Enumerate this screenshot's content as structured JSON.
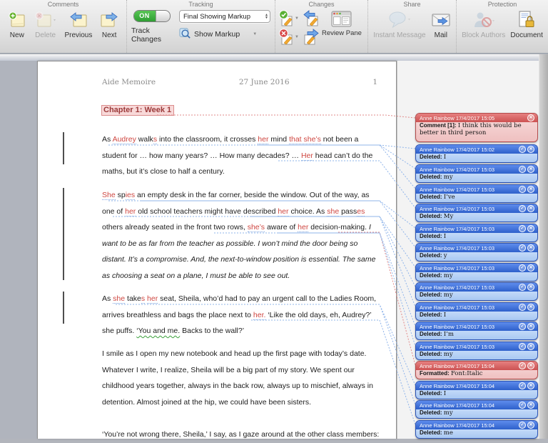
{
  "ribbon": {
    "comments": {
      "label": "Comments",
      "new": "New",
      "delete": "Delete",
      "previous": "Previous",
      "next": "Next"
    },
    "tracking": {
      "label": "Tracking",
      "toggle_state": "ON",
      "track_changes": "Track Changes",
      "view_mode": "Final Showing Markup",
      "show_markup": "Show Markup"
    },
    "changes": {
      "label": "Changes",
      "review_pane": "Review Pane"
    },
    "share": {
      "label": "Share",
      "instant_message": "Instant Message",
      "mail": "Mail"
    },
    "protection": {
      "label": "Protection",
      "block_authors": "Block Authors",
      "document": "Document"
    }
  },
  "document": {
    "header": {
      "title": "Aide Memoire",
      "date": "27 June 2016",
      "page_number": "1"
    },
    "chapter_heading": "Chapter 1: Week 1",
    "paragraphs": [
      {
        "runs": [
          {
            "t": "As ",
            "s": "n"
          },
          {
            "t": "Audrey",
            "s": "ins"
          },
          {
            "t": " walk",
            "s": "n"
          },
          {
            "t": "s",
            "s": "ins"
          },
          {
            "t": " into the classroom, it crosses ",
            "s": "n"
          },
          {
            "t": "her",
            "s": "ins"
          },
          {
            "t": " mind ",
            "s": "n"
          },
          {
            "t": "that she’s",
            "s": "ins"
          },
          {
            "t": " not been a student for … how many years? … How many decades? … ",
            "s": "n"
          },
          {
            "t": "Her",
            "s": "ins"
          },
          {
            "t": " head can’t do the maths, but it’s close to half a century.",
            "s": "n"
          }
        ]
      },
      {
        "runs": [
          {
            "t": "She",
            "s": "ins"
          },
          {
            "t": " sp",
            "s": "n"
          },
          {
            "t": "ies",
            "s": "ins"
          },
          {
            "t": " an empty desk in the far corner, beside the window. Out of the way, as one of ",
            "s": "n"
          },
          {
            "t": "her",
            "s": "ins"
          },
          {
            "t": " old school teachers might have described ",
            "s": "n"
          },
          {
            "t": "her",
            "s": "ins"
          },
          {
            "t": " choice. As ",
            "s": "n"
          },
          {
            "t": "she",
            "s": "ins"
          },
          {
            "t": " pass",
            "s": "n"
          },
          {
            "t": "es",
            "s": "ins"
          },
          {
            "t": " others already seated in the front two rows, ",
            "s": "n"
          },
          {
            "t": "she’s",
            "s": "ins"
          },
          {
            "t": " aware of ",
            "s": "n"
          },
          {
            "t": "her",
            "s": "ins"
          },
          {
            "t": " decision-making. ",
            "s": "n"
          },
          {
            "t": "I want to be as far from the teacher as possible. I won’t mind the door being so distant. It’s a compromise. And, the next-to-window position is essential. The same as choosing a seat on a plane, I must be able to see out.",
            "s": "it"
          }
        ]
      },
      {
        "runs": [
          {
            "t": "As ",
            "s": "n"
          },
          {
            "t": "she",
            "s": "ins"
          },
          {
            "t": " take",
            "s": "n"
          },
          {
            "t": "s",
            "s": "ins"
          },
          {
            "t": " ",
            "s": "n"
          },
          {
            "t": "her",
            "s": "ins"
          },
          {
            "t": " seat, Sheila, who’d had to pay an urgent call to the Ladies Room, arrives breathless and bags the place next to ",
            "s": "n"
          },
          {
            "t": "her.",
            "s": "ins"
          },
          {
            "t": " ‘Like the old days, eh, Audrey?’ she puffs. ",
            "s": "n"
          },
          {
            "t": "‘You and me.",
            "s": "gr"
          },
          {
            "t": " Backs to the wall?’",
            "s": "n"
          }
        ]
      },
      {
        "runs": [
          {
            "t": "I smile as I open my new notebook and head up the first page with today’s date. Whatever I write, I realize, Sheila will be a big part of my story. We spent our childhood years together, always in the back row, always up to mischief, always in detention. Almost joined at the hip, we could have been sisters.",
            "s": "n"
          }
        ]
      },
      {
        "runs": [
          {
            "t": "‘You’re not wrong there, Sheila,’ I say, as I gaze around at the other class members:",
            "s": "n"
          }
        ]
      }
    ]
  },
  "comments": [
    {
      "author": "Anne Rainbow",
      "time": "17/4/2017 15:05",
      "label": "Comment [1]:",
      "text": "I think this would be better in third person",
      "variant": "red",
      "actions": [
        "close"
      ]
    },
    {
      "author": "Anne Rainbow",
      "time": "17/4/2017 15:02",
      "label": "Deleted:",
      "text": "I",
      "variant": "blue",
      "actions": [
        "accept",
        "close"
      ]
    },
    {
      "author": "Anne Rainbow",
      "time": "17/4/2017 15:03",
      "label": "Deleted:",
      "text": "my",
      "variant": "blue",
      "actions": [
        "accept",
        "close"
      ]
    },
    {
      "author": "Anne Rainbow",
      "time": "17/4/2017 15:03",
      "label": "Deleted:",
      "text": "I’ve",
      "variant": "blue",
      "actions": [
        "accept",
        "close"
      ]
    },
    {
      "author": "Anne Rainbow",
      "time": "17/4/2017 15:03",
      "label": "Deleted:",
      "text": "My",
      "variant": "blue",
      "actions": [
        "accept",
        "close"
      ]
    },
    {
      "author": "Anne Rainbow",
      "time": "17/4/2017 15:03",
      "label": "Deleted:",
      "text": "I",
      "variant": "blue",
      "actions": [
        "accept",
        "close"
      ]
    },
    {
      "author": "Anne Rainbow",
      "time": "17/4/2017 15:03",
      "label": "Deleted:",
      "text": "y",
      "variant": "blue",
      "actions": [
        "accept",
        "close"
      ]
    },
    {
      "author": "Anne Rainbow",
      "time": "17/4/2017 15:03",
      "label": "Deleted:",
      "text": "my",
      "variant": "blue",
      "actions": [
        "accept",
        "close"
      ]
    },
    {
      "author": "Anne Rainbow",
      "time": "17/4/2017 15:03",
      "label": "Deleted:",
      "text": "my",
      "variant": "blue",
      "actions": [
        "accept",
        "close"
      ]
    },
    {
      "author": "Anne Rainbow",
      "time": "17/4/2017 15:03",
      "label": "Deleted:",
      "text": "I",
      "variant": "blue",
      "actions": [
        "accept",
        "close"
      ]
    },
    {
      "author": "Anne Rainbow",
      "time": "17/4/2017 15:03",
      "label": "Deleted:",
      "text": "I’m",
      "variant": "blue",
      "actions": [
        "accept",
        "close"
      ]
    },
    {
      "author": "Anne Rainbow",
      "time": "17/4/2017 15:03",
      "label": "Deleted:",
      "text": "my",
      "variant": "blue",
      "actions": [
        "accept",
        "close"
      ]
    },
    {
      "author": "Anne Rainbow",
      "time": "17/4/2017 15:04",
      "label": "Formatted:",
      "text": "Font:Italic",
      "variant": "red",
      "actions": [
        "accept",
        "close"
      ]
    },
    {
      "author": "Anne Rainbow",
      "time": "17/4/2017 15:04",
      "label": "Deleted:",
      "text": "I",
      "variant": "blue",
      "actions": [
        "accept",
        "close"
      ]
    },
    {
      "author": "Anne Rainbow",
      "time": "17/4/2017 15:04",
      "label": "Deleted:",
      "text": "my",
      "variant": "blue",
      "actions": [
        "accept",
        "close"
      ]
    },
    {
      "author": "Anne Rainbow",
      "time": "17/4/2017 15:04",
      "label": "Deleted:",
      "text": "me",
      "variant": "blue",
      "actions": [
        "accept",
        "close"
      ]
    }
  ],
  "colors": {
    "insertion_red": "#cf4741",
    "comment_red_header": "#cd5252",
    "change_blue_header": "#2e60cb",
    "toggle_green": "#2f9e33"
  }
}
